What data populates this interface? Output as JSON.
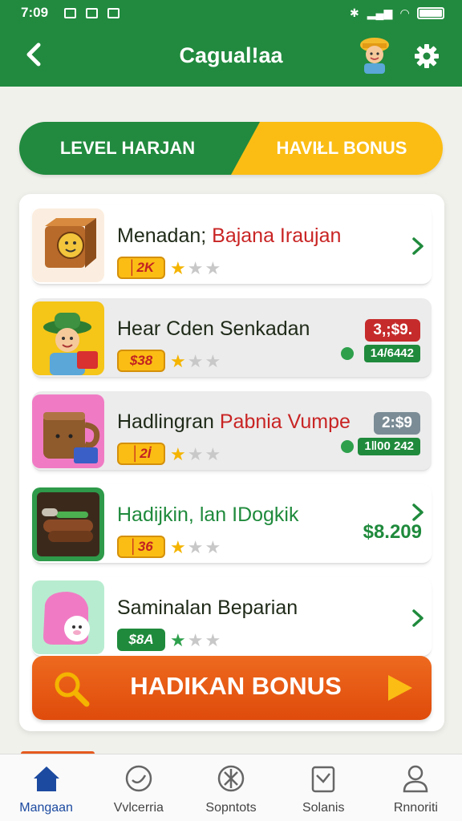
{
  "status_bar": {
    "time": "7:09"
  },
  "header": {
    "title": "Cagual!aa"
  },
  "tabs": [
    {
      "label": "LEVEL HARJAN",
      "active": true
    },
    {
      "label": "HAVIŁL BONUS",
      "active": false
    }
  ],
  "items": [
    {
      "title": "Menadan; ",
      "title_highlight": "Bajana Iraujan",
      "chip": "│2K",
      "stars": 1,
      "max_stars": 3,
      "thumb": "box-face-icon"
    },
    {
      "title": "Hear Cden ",
      "title_highlight": "Senkadan",
      "chip": "$38",
      "stars": 1,
      "max_stars": 3,
      "price_badge": "3,;$9.",
      "count": "14/6442",
      "thumb": "farmer-icon"
    },
    {
      "title": "Hadlingran ",
      "title_highlight": "Pabnia Vumpe",
      "chip": "│2İ",
      "stars": 1,
      "max_stars": 3,
      "price_badge": "2:$9",
      "count": "1ǁ00 242",
      "thumb": "mug-icon"
    },
    {
      "title": "Hadijkin, lan IDogkik",
      "title_highlight": "",
      "chip": "│36",
      "stars": 1,
      "max_stars": 3,
      "price": "$8.209",
      "thumb": "food-icon"
    },
    {
      "title": "Saminalan Beparian",
      "title_highlight": "",
      "chip": "$8A",
      "stars": 1,
      "max_stars": 3,
      "thumb": "pig-icon"
    }
  ],
  "bonus_button": {
    "label": "HADIKAN BONUS"
  },
  "bottom_nav": [
    {
      "label": "Mangaan",
      "icon": "home-icon",
      "active": true
    },
    {
      "label": "Vvlcerria",
      "icon": "smile-icon",
      "active": false
    },
    {
      "label": "Sopntots",
      "icon": "sun-icon",
      "active": false
    },
    {
      "label": "Solanis",
      "icon": "doc-icon",
      "active": false
    },
    {
      "label": "Rnnoriti",
      "icon": "person-icon",
      "active": false
    }
  ],
  "colors": {
    "primary_green": "#218a3e",
    "accent_yellow": "#fbbd14",
    "accent_orange": "#e55a1e",
    "danger_red": "#c62b2b"
  }
}
